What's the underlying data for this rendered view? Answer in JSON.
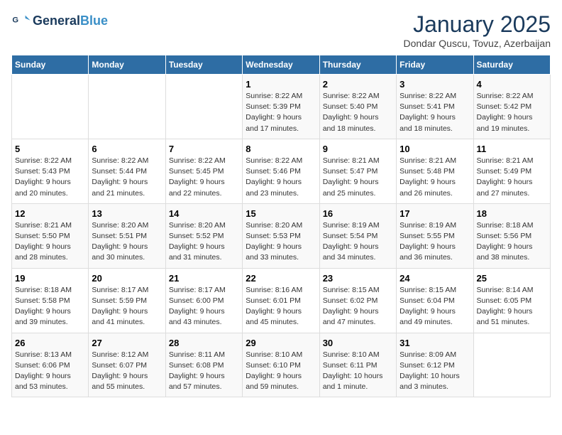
{
  "header": {
    "logo_line1": "General",
    "logo_line2": "Blue",
    "month_title": "January 2025",
    "subtitle": "Dondar Quscu, Tovuz, Azerbaijan"
  },
  "weekdays": [
    "Sunday",
    "Monday",
    "Tuesday",
    "Wednesday",
    "Thursday",
    "Friday",
    "Saturday"
  ],
  "weeks": [
    [
      {
        "day": "",
        "info": ""
      },
      {
        "day": "",
        "info": ""
      },
      {
        "day": "",
        "info": ""
      },
      {
        "day": "1",
        "info": "Sunrise: 8:22 AM\nSunset: 5:39 PM\nDaylight: 9 hours\nand 17 minutes."
      },
      {
        "day": "2",
        "info": "Sunrise: 8:22 AM\nSunset: 5:40 PM\nDaylight: 9 hours\nand 18 minutes."
      },
      {
        "day": "3",
        "info": "Sunrise: 8:22 AM\nSunset: 5:41 PM\nDaylight: 9 hours\nand 18 minutes."
      },
      {
        "day": "4",
        "info": "Sunrise: 8:22 AM\nSunset: 5:42 PM\nDaylight: 9 hours\nand 19 minutes."
      }
    ],
    [
      {
        "day": "5",
        "info": "Sunrise: 8:22 AM\nSunset: 5:43 PM\nDaylight: 9 hours\nand 20 minutes."
      },
      {
        "day": "6",
        "info": "Sunrise: 8:22 AM\nSunset: 5:44 PM\nDaylight: 9 hours\nand 21 minutes."
      },
      {
        "day": "7",
        "info": "Sunrise: 8:22 AM\nSunset: 5:45 PM\nDaylight: 9 hours\nand 22 minutes."
      },
      {
        "day": "8",
        "info": "Sunrise: 8:22 AM\nSunset: 5:46 PM\nDaylight: 9 hours\nand 23 minutes."
      },
      {
        "day": "9",
        "info": "Sunrise: 8:21 AM\nSunset: 5:47 PM\nDaylight: 9 hours\nand 25 minutes."
      },
      {
        "day": "10",
        "info": "Sunrise: 8:21 AM\nSunset: 5:48 PM\nDaylight: 9 hours\nand 26 minutes."
      },
      {
        "day": "11",
        "info": "Sunrise: 8:21 AM\nSunset: 5:49 PM\nDaylight: 9 hours\nand 27 minutes."
      }
    ],
    [
      {
        "day": "12",
        "info": "Sunrise: 8:21 AM\nSunset: 5:50 PM\nDaylight: 9 hours\nand 28 minutes."
      },
      {
        "day": "13",
        "info": "Sunrise: 8:20 AM\nSunset: 5:51 PM\nDaylight: 9 hours\nand 30 minutes."
      },
      {
        "day": "14",
        "info": "Sunrise: 8:20 AM\nSunset: 5:52 PM\nDaylight: 9 hours\nand 31 minutes."
      },
      {
        "day": "15",
        "info": "Sunrise: 8:20 AM\nSunset: 5:53 PM\nDaylight: 9 hours\nand 33 minutes."
      },
      {
        "day": "16",
        "info": "Sunrise: 8:19 AM\nSunset: 5:54 PM\nDaylight: 9 hours\nand 34 minutes."
      },
      {
        "day": "17",
        "info": "Sunrise: 8:19 AM\nSunset: 5:55 PM\nDaylight: 9 hours\nand 36 minutes."
      },
      {
        "day": "18",
        "info": "Sunrise: 8:18 AM\nSunset: 5:56 PM\nDaylight: 9 hours\nand 38 minutes."
      }
    ],
    [
      {
        "day": "19",
        "info": "Sunrise: 8:18 AM\nSunset: 5:58 PM\nDaylight: 9 hours\nand 39 minutes."
      },
      {
        "day": "20",
        "info": "Sunrise: 8:17 AM\nSunset: 5:59 PM\nDaylight: 9 hours\nand 41 minutes."
      },
      {
        "day": "21",
        "info": "Sunrise: 8:17 AM\nSunset: 6:00 PM\nDaylight: 9 hours\nand 43 minutes."
      },
      {
        "day": "22",
        "info": "Sunrise: 8:16 AM\nSunset: 6:01 PM\nDaylight: 9 hours\nand 45 minutes."
      },
      {
        "day": "23",
        "info": "Sunrise: 8:15 AM\nSunset: 6:02 PM\nDaylight: 9 hours\nand 47 minutes."
      },
      {
        "day": "24",
        "info": "Sunrise: 8:15 AM\nSunset: 6:04 PM\nDaylight: 9 hours\nand 49 minutes."
      },
      {
        "day": "25",
        "info": "Sunrise: 8:14 AM\nSunset: 6:05 PM\nDaylight: 9 hours\nand 51 minutes."
      }
    ],
    [
      {
        "day": "26",
        "info": "Sunrise: 8:13 AM\nSunset: 6:06 PM\nDaylight: 9 hours\nand 53 minutes."
      },
      {
        "day": "27",
        "info": "Sunrise: 8:12 AM\nSunset: 6:07 PM\nDaylight: 9 hours\nand 55 minutes."
      },
      {
        "day": "28",
        "info": "Sunrise: 8:11 AM\nSunset: 6:08 PM\nDaylight: 9 hours\nand 57 minutes."
      },
      {
        "day": "29",
        "info": "Sunrise: 8:10 AM\nSunset: 6:10 PM\nDaylight: 9 hours\nand 59 minutes."
      },
      {
        "day": "30",
        "info": "Sunrise: 8:10 AM\nSunset: 6:11 PM\nDaylight: 10 hours\nand 1 minute."
      },
      {
        "day": "31",
        "info": "Sunrise: 8:09 AM\nSunset: 6:12 PM\nDaylight: 10 hours\nand 3 minutes."
      },
      {
        "day": "",
        "info": ""
      }
    ]
  ]
}
